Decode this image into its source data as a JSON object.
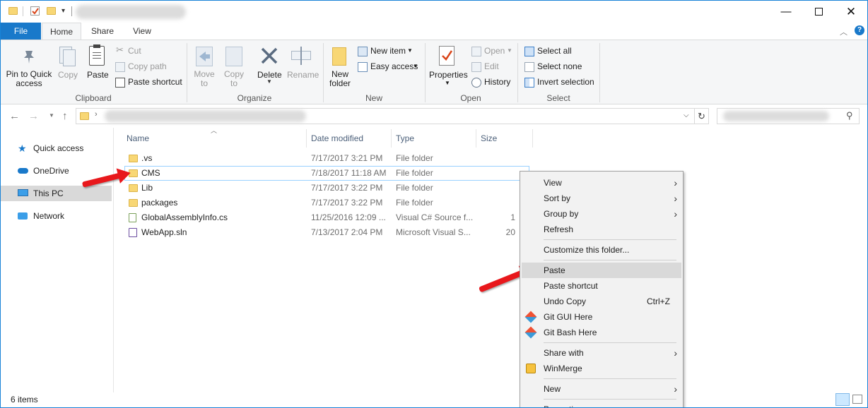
{
  "ribbon_tabs": [
    "File",
    "Home",
    "Share",
    "View"
  ],
  "clipboard": {
    "pin": "Pin to Quick access",
    "copy": "Copy",
    "paste": "Paste",
    "cut": "Cut",
    "copy_path": "Copy path",
    "paste_shortcut": "Paste shortcut",
    "label": "Clipboard"
  },
  "organize": {
    "move_to": "Move to",
    "copy_to": "Copy to",
    "delete": "Delete",
    "rename": "Rename",
    "label": "Organize"
  },
  "new_group": {
    "new_folder": "New folder",
    "new_item": "New item",
    "easy_access": "Easy access",
    "label": "New"
  },
  "open_group": {
    "properties": "Properties",
    "open": "Open",
    "edit": "Edit",
    "history": "History",
    "label": "Open"
  },
  "select_group": {
    "select_all": "Select all",
    "select_none": "Select none",
    "invert": "Invert selection",
    "label": "Select"
  },
  "nav_pane": [
    {
      "label": "Quick access",
      "icon": "star-icon"
    },
    {
      "label": "OneDrive",
      "icon": "cloud-icon"
    },
    {
      "label": "This PC",
      "icon": "computer-icon"
    },
    {
      "label": "Network",
      "icon": "network-icon"
    }
  ],
  "columns": {
    "name": "Name",
    "date": "Date modified",
    "type": "Type",
    "size": "Size"
  },
  "files": [
    {
      "name": ".vs",
      "date": "7/17/2017 3:21 PM",
      "type": "File folder",
      "size": "",
      "icon": "folder-icon"
    },
    {
      "name": "CMS",
      "date": "7/18/2017 11:18 AM",
      "type": "File folder",
      "size": "",
      "icon": "folder-icon"
    },
    {
      "name": "Lib",
      "date": "7/17/2017 3:22 PM",
      "type": "File folder",
      "size": "",
      "icon": "folder-icon"
    },
    {
      "name": "packages",
      "date": "7/17/2017 3:22 PM",
      "type": "File folder",
      "size": "",
      "icon": "folder-icon"
    },
    {
      "name": "GlobalAssemblyInfo.cs",
      "date": "11/25/2016 12:09 ...",
      "type": "Visual C# Source f...",
      "size": "1",
      "icon": "csharp-file-icon"
    },
    {
      "name": "WebApp.sln",
      "date": "7/13/2017 2:04 PM",
      "type": "Microsoft Visual S...",
      "size": "20",
      "icon": "solution-file-icon"
    }
  ],
  "context_menu": {
    "view": "View",
    "sort_by": "Sort by",
    "group_by": "Group by",
    "refresh": "Refresh",
    "customize": "Customize this folder...",
    "paste": "Paste",
    "paste_shortcut": "Paste shortcut",
    "undo_copy": "Undo Copy",
    "undo_shortcut": "Ctrl+Z",
    "git_gui": "Git GUI Here",
    "git_bash": "Git Bash Here",
    "share_with": "Share with",
    "winmerge": "WinMerge",
    "new": "New",
    "properties": "Properties"
  },
  "status": {
    "items": "6 items"
  },
  "colors": {
    "accent": "#1979ca",
    "arrow": "#e8181c",
    "folder": "#f8d775"
  }
}
